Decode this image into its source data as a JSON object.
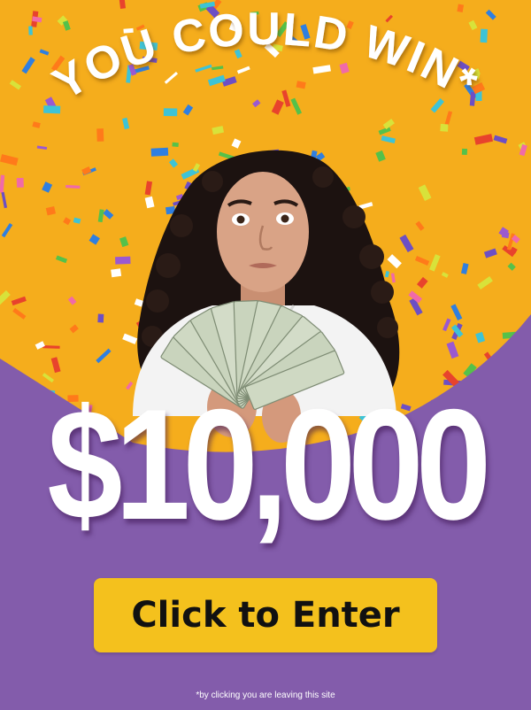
{
  "colors": {
    "background_yellow": "#f5ad1c",
    "panel_purple": "#835cab",
    "button_yellow": "#f4c11d",
    "text_white": "#ffffff"
  },
  "headline": "YOU COULD WIN*",
  "prize_amount": "$10,000",
  "photo": {
    "description_icon": "woman-holding-cash-photo"
  },
  "cta_label": "Click to Enter",
  "disclaimer": "*by clicking you are leaving this site",
  "decor": "confetti"
}
